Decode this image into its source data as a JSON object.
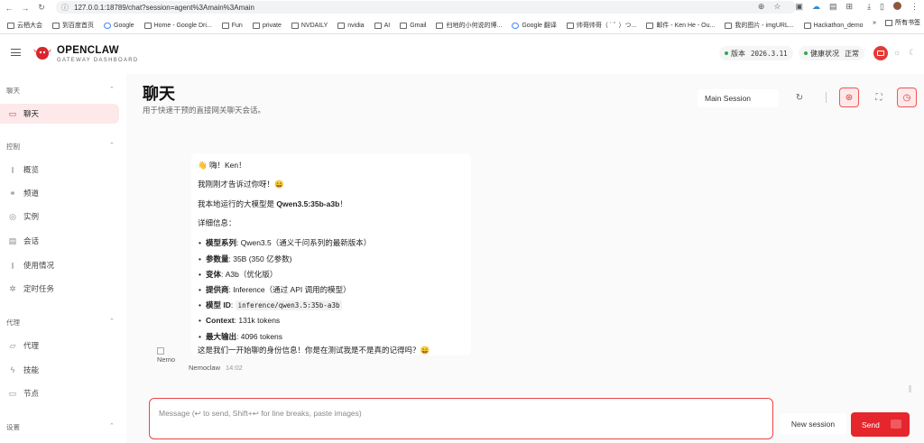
{
  "browser": {
    "url": "127.0.0.1:18789/chat?session=agent%3Amain%3Amain",
    "bookmarks": [
      "云栖大会",
      "到百度首页",
      "Google",
      "Home - Google Dri...",
      "Fun",
      "private",
      "NVDAILY",
      "nvidia",
      "AI",
      "Gmail",
      "扫地的小何说的博...",
      "Google 翻译",
      "帅哥帅哥（ ´ ﾟ ）つ...",
      "邮件 - Ken He - Ou...",
      "我的图片 - imgURL...",
      "Hackathon_demo"
    ],
    "bookmarks_more": "»",
    "all_bookmarks": "所有书签"
  },
  "header": {
    "brand": "OPENCLAW",
    "subtitle": "GATEWAY DASHBOARD",
    "version_label": "版本",
    "version": "2026.3.11",
    "health_label": "健康状况",
    "health_status": "正常"
  },
  "sidebar": {
    "sections": [
      {
        "label": "聊天",
        "items": [
          {
            "label": "聊天",
            "icon": "chat-icon",
            "active": true
          }
        ]
      },
      {
        "label": "控制",
        "items": [
          {
            "label": "概览",
            "icon": "bar-chart-icon"
          },
          {
            "label": "频道",
            "icon": "link-icon"
          },
          {
            "label": "实例",
            "icon": "radio-icon"
          },
          {
            "label": "会话",
            "icon": "document-icon"
          },
          {
            "label": "使用情况",
            "icon": "bar-chart-icon"
          },
          {
            "label": "定时任务",
            "icon": "loader-icon"
          }
        ]
      },
      {
        "label": "代理",
        "items": [
          {
            "label": "代理",
            "icon": "folder-icon"
          },
          {
            "label": "技能",
            "icon": "zap-icon"
          },
          {
            "label": "节点",
            "icon": "monitor-icon"
          }
        ]
      },
      {
        "label": "设置",
        "items": []
      }
    ]
  },
  "page": {
    "title": "聊天",
    "subtitle": "用于快速干预的直接网关聊天会话。",
    "session": "Main Session"
  },
  "message": {
    "greeting": "👋 嗨！Ken！",
    "line1": "我刚刚才告诉过你呀！😄",
    "line2_prefix": "我本地运行的大模型是 ",
    "line2_model": "Qwen3.5:35b-a3b",
    "line2_suffix": "！",
    "details_title": "详细信息：",
    "details": [
      {
        "key": "模型系列",
        "value": ": Qwen3.5（通义千问系列的最新版本）"
      },
      {
        "key": "参数量",
        "value": ": 35B (350 亿参数)"
      },
      {
        "key": "变体",
        "value": ": A3b（优化版）"
      },
      {
        "key": "提供商",
        "value": ": Inference（通过 API 调用的模型）"
      },
      {
        "key": "模型 ID",
        "value": ": ",
        "code": "inference/qwen3.5:35b-a3b"
      },
      {
        "key": "Context",
        "value": ": 131k tokens"
      },
      {
        "key": "最大输出",
        "value": ": 4096 tokens"
      }
    ],
    "closing": "这是我们一开始聊的身份信息！你是在测试我是不是真的记得吗？😄",
    "avatar_alt": "Nemo",
    "sender": "Nemoclaw",
    "time": "14:02"
  },
  "composer": {
    "placeholder": "Message (↩ to send, Shift+↩ for line breaks, paste images)",
    "new_session": "New session",
    "send": "Send"
  }
}
